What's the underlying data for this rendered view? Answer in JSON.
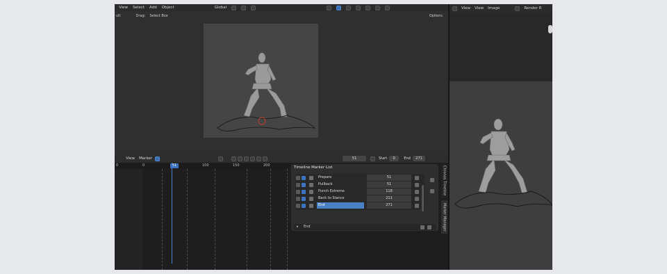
{
  "header": {
    "menus": [
      "View",
      "Select",
      "Add",
      "Object"
    ],
    "orientation": "Global",
    "tool_left": "ult",
    "drag_label": "Drag:",
    "drag_value": "Select Box",
    "options": "Options"
  },
  "right_panel": {
    "menus": [
      "View",
      "View",
      "Image"
    ],
    "render_label": "Render R"
  },
  "timeline": {
    "menus": [
      "View",
      "Marker"
    ],
    "current_frame": "51",
    "start_label": "Start",
    "start_value": "0",
    "end_label": "End",
    "end_value": "271",
    "ruler": [
      "0",
      "0",
      "51",
      "100",
      "150",
      "200"
    ]
  },
  "marker_panel": {
    "title": "Timeline Marker List",
    "items": [
      {
        "name": "Prepare",
        "frame": "51"
      },
      {
        "name": "Pullback",
        "frame": "51"
      },
      {
        "name": "Punch Extreme",
        "frame": "118"
      },
      {
        "name": "Back to Stance",
        "frame": "211"
      },
      {
        "name": "End",
        "frame": "271"
      }
    ],
    "selected_index": 4,
    "selected_field": "End"
  },
  "vertical_tabs": [
    "Chronos Timeline",
    "Marker Manager"
  ],
  "colors": {
    "accent": "#4a7fc3",
    "bg": "#262626"
  }
}
